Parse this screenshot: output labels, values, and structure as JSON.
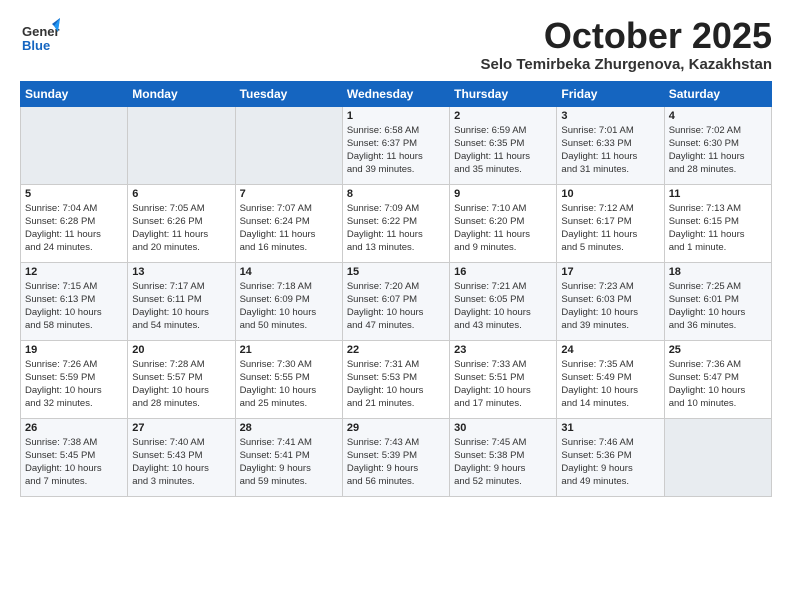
{
  "header": {
    "logo_general": "General",
    "logo_blue": "Blue",
    "title": "October 2025",
    "subtitle": "Selo Temirbeka Zhurgenova, Kazakhstan"
  },
  "weekdays": [
    "Sunday",
    "Monday",
    "Tuesday",
    "Wednesday",
    "Thursday",
    "Friday",
    "Saturday"
  ],
  "weeks": [
    [
      {
        "day": "",
        "info": ""
      },
      {
        "day": "",
        "info": ""
      },
      {
        "day": "",
        "info": ""
      },
      {
        "day": "1",
        "info": "Sunrise: 6:58 AM\nSunset: 6:37 PM\nDaylight: 11 hours\nand 39 minutes."
      },
      {
        "day": "2",
        "info": "Sunrise: 6:59 AM\nSunset: 6:35 PM\nDaylight: 11 hours\nand 35 minutes."
      },
      {
        "day": "3",
        "info": "Sunrise: 7:01 AM\nSunset: 6:33 PM\nDaylight: 11 hours\nand 31 minutes."
      },
      {
        "day": "4",
        "info": "Sunrise: 7:02 AM\nSunset: 6:30 PM\nDaylight: 11 hours\nand 28 minutes."
      }
    ],
    [
      {
        "day": "5",
        "info": "Sunrise: 7:04 AM\nSunset: 6:28 PM\nDaylight: 11 hours\nand 24 minutes."
      },
      {
        "day": "6",
        "info": "Sunrise: 7:05 AM\nSunset: 6:26 PM\nDaylight: 11 hours\nand 20 minutes."
      },
      {
        "day": "7",
        "info": "Sunrise: 7:07 AM\nSunset: 6:24 PM\nDaylight: 11 hours\nand 16 minutes."
      },
      {
        "day": "8",
        "info": "Sunrise: 7:09 AM\nSunset: 6:22 PM\nDaylight: 11 hours\nand 13 minutes."
      },
      {
        "day": "9",
        "info": "Sunrise: 7:10 AM\nSunset: 6:20 PM\nDaylight: 11 hours\nand 9 minutes."
      },
      {
        "day": "10",
        "info": "Sunrise: 7:12 AM\nSunset: 6:17 PM\nDaylight: 11 hours\nand 5 minutes."
      },
      {
        "day": "11",
        "info": "Sunrise: 7:13 AM\nSunset: 6:15 PM\nDaylight: 11 hours\nand 1 minute."
      }
    ],
    [
      {
        "day": "12",
        "info": "Sunrise: 7:15 AM\nSunset: 6:13 PM\nDaylight: 10 hours\nand 58 minutes."
      },
      {
        "day": "13",
        "info": "Sunrise: 7:17 AM\nSunset: 6:11 PM\nDaylight: 10 hours\nand 54 minutes."
      },
      {
        "day": "14",
        "info": "Sunrise: 7:18 AM\nSunset: 6:09 PM\nDaylight: 10 hours\nand 50 minutes."
      },
      {
        "day": "15",
        "info": "Sunrise: 7:20 AM\nSunset: 6:07 PM\nDaylight: 10 hours\nand 47 minutes."
      },
      {
        "day": "16",
        "info": "Sunrise: 7:21 AM\nSunset: 6:05 PM\nDaylight: 10 hours\nand 43 minutes."
      },
      {
        "day": "17",
        "info": "Sunrise: 7:23 AM\nSunset: 6:03 PM\nDaylight: 10 hours\nand 39 minutes."
      },
      {
        "day": "18",
        "info": "Sunrise: 7:25 AM\nSunset: 6:01 PM\nDaylight: 10 hours\nand 36 minutes."
      }
    ],
    [
      {
        "day": "19",
        "info": "Sunrise: 7:26 AM\nSunset: 5:59 PM\nDaylight: 10 hours\nand 32 minutes."
      },
      {
        "day": "20",
        "info": "Sunrise: 7:28 AM\nSunset: 5:57 PM\nDaylight: 10 hours\nand 28 minutes."
      },
      {
        "day": "21",
        "info": "Sunrise: 7:30 AM\nSunset: 5:55 PM\nDaylight: 10 hours\nand 25 minutes."
      },
      {
        "day": "22",
        "info": "Sunrise: 7:31 AM\nSunset: 5:53 PM\nDaylight: 10 hours\nand 21 minutes."
      },
      {
        "day": "23",
        "info": "Sunrise: 7:33 AM\nSunset: 5:51 PM\nDaylight: 10 hours\nand 17 minutes."
      },
      {
        "day": "24",
        "info": "Sunrise: 7:35 AM\nSunset: 5:49 PM\nDaylight: 10 hours\nand 14 minutes."
      },
      {
        "day": "25",
        "info": "Sunrise: 7:36 AM\nSunset: 5:47 PM\nDaylight: 10 hours\nand 10 minutes."
      }
    ],
    [
      {
        "day": "26",
        "info": "Sunrise: 7:38 AM\nSunset: 5:45 PM\nDaylight: 10 hours\nand 7 minutes."
      },
      {
        "day": "27",
        "info": "Sunrise: 7:40 AM\nSunset: 5:43 PM\nDaylight: 10 hours\nand 3 minutes."
      },
      {
        "day": "28",
        "info": "Sunrise: 7:41 AM\nSunset: 5:41 PM\nDaylight: 9 hours\nand 59 minutes."
      },
      {
        "day": "29",
        "info": "Sunrise: 7:43 AM\nSunset: 5:39 PM\nDaylight: 9 hours\nand 56 minutes."
      },
      {
        "day": "30",
        "info": "Sunrise: 7:45 AM\nSunset: 5:38 PM\nDaylight: 9 hours\nand 52 minutes."
      },
      {
        "day": "31",
        "info": "Sunrise: 7:46 AM\nSunset: 5:36 PM\nDaylight: 9 hours\nand 49 minutes."
      },
      {
        "day": "",
        "info": ""
      }
    ]
  ]
}
